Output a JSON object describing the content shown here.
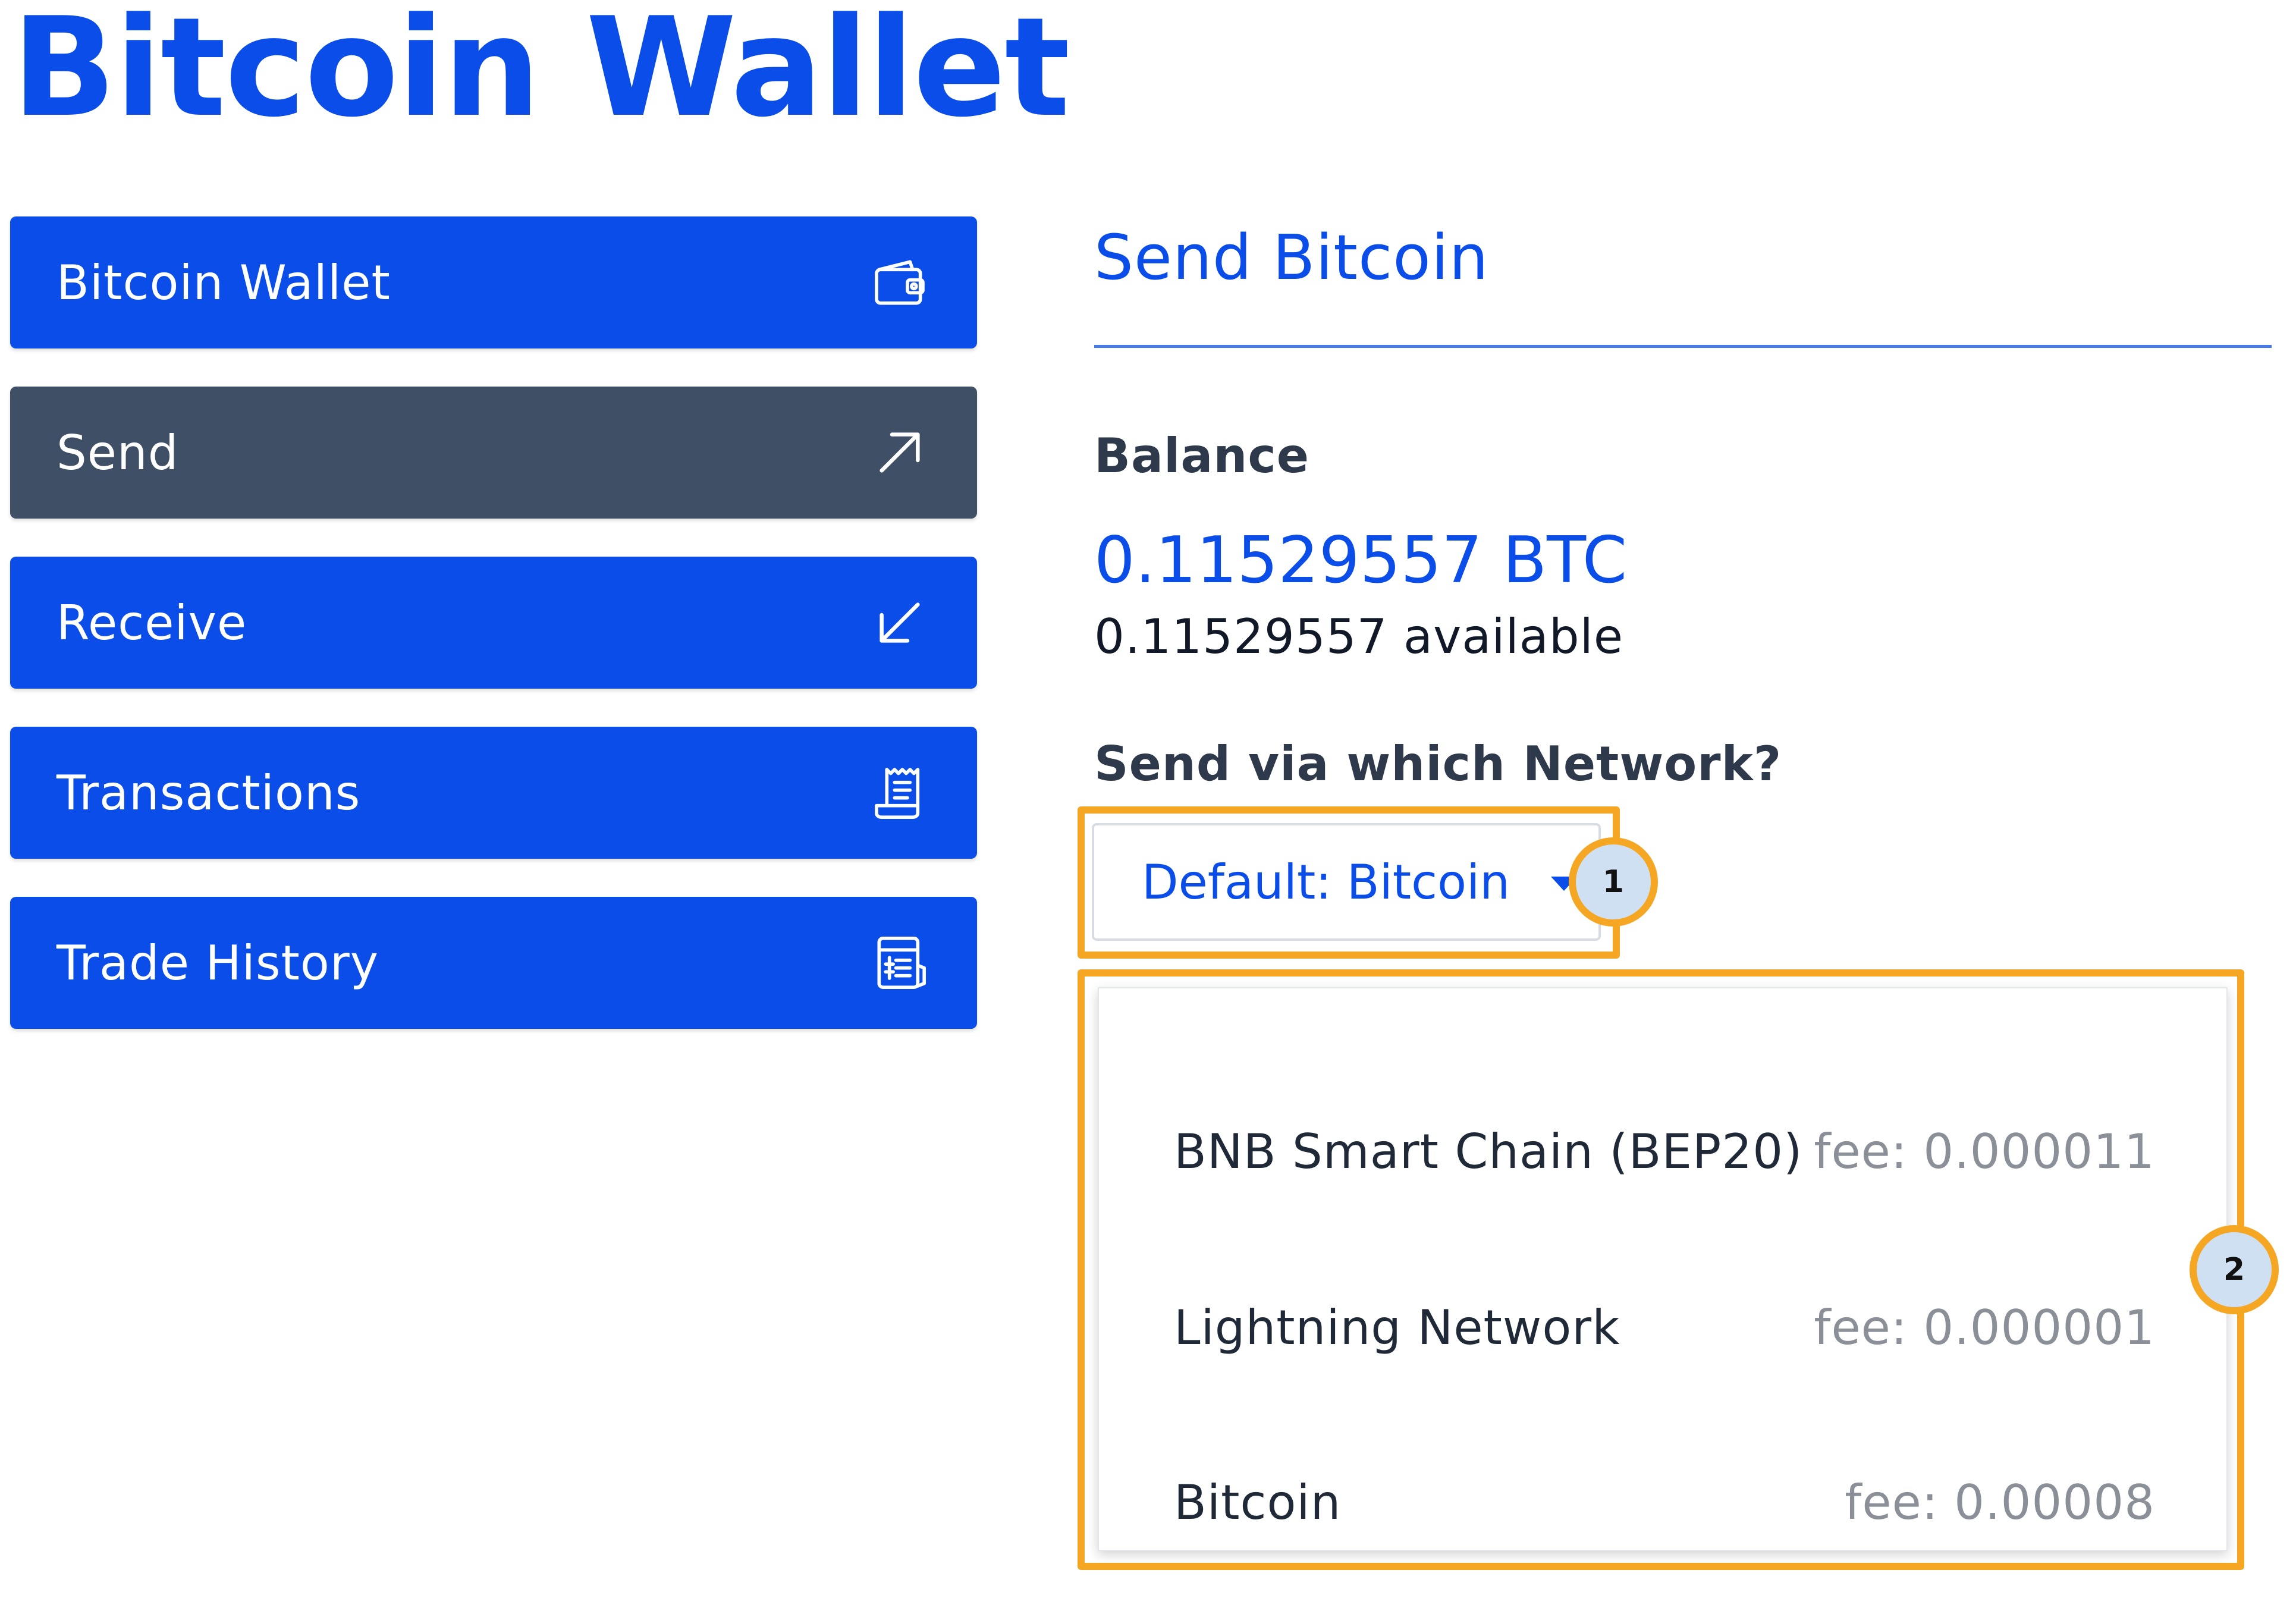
{
  "app": {
    "title": "Bitcoin Wallet"
  },
  "sidebar": {
    "items": [
      {
        "label": "Bitcoin Wallet",
        "icon": "wallet-icon",
        "active": false
      },
      {
        "label": "Send",
        "icon": "arrow-up-right-icon",
        "active": true
      },
      {
        "label": "Receive",
        "icon": "arrow-down-left-icon",
        "active": false
      },
      {
        "label": "Transactions",
        "icon": "receipt-icon",
        "active": false
      },
      {
        "label": "Trade History",
        "icon": "ledger-icon",
        "active": false
      }
    ]
  },
  "main": {
    "title": "Send Bitcoin",
    "balance_label": "Balance",
    "balance_value": "0.11529557 BTC",
    "balance_available": "0.11529557 available",
    "network_question": "Send via which Network?",
    "network_select": {
      "value": "Default: Bitcoin"
    },
    "network_options": [
      {
        "name": "BNB Smart Chain (BEP20)",
        "fee": "fee: 0.000011"
      },
      {
        "name": "Lightning Network",
        "fee": "fee: 0.000001"
      },
      {
        "name": "Bitcoin",
        "fee": "fee: 0.00008"
      }
    ]
  },
  "annotations": {
    "callout_1": "1",
    "callout_2": "2"
  },
  "colors": {
    "primary": "#0a4de8",
    "active_nav": "#3e4f66",
    "highlight": "#f5a623",
    "callout_fill": "#cfe0f2"
  }
}
